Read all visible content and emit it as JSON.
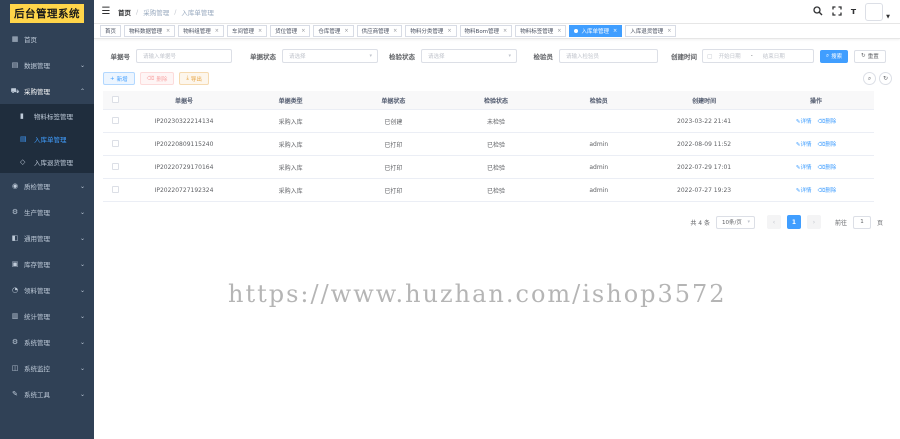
{
  "app": {
    "logo_text": "后台管理系统"
  },
  "sidebar": {
    "items": [
      {
        "label": "首页",
        "icon": "dashboard-icon",
        "glyph": "▦"
      },
      {
        "label": "数据管理",
        "icon": "data-icon",
        "glyph": "▤"
      },
      {
        "label": "采购管理",
        "icon": "cart-icon",
        "glyph": "⛟",
        "open": true
      },
      {
        "label": "质检管理",
        "icon": "inspect-icon",
        "glyph": "◉"
      },
      {
        "label": "生产管理",
        "icon": "production-icon",
        "glyph": "⚙"
      },
      {
        "label": "通用管理",
        "icon": "common-icon",
        "glyph": "◧"
      },
      {
        "label": "库存管理",
        "icon": "stock-icon",
        "glyph": "▣"
      },
      {
        "label": "领料管理",
        "icon": "material-icon",
        "glyph": "◔"
      },
      {
        "label": "统计管理",
        "icon": "stats-icon",
        "glyph": "▥"
      },
      {
        "label": "系统管理",
        "icon": "system-icon",
        "glyph": "⚙"
      },
      {
        "label": "系统监控",
        "icon": "monitor-icon",
        "glyph": "◫"
      },
      {
        "label": "系统工具",
        "icon": "tools-icon",
        "glyph": "✎"
      }
    ],
    "submenu": [
      {
        "label": "物料标签管理",
        "icon": "label-icon",
        "glyph": "▮"
      },
      {
        "label": "入库单管理",
        "icon": "receipt-icon",
        "glyph": "▤",
        "active": true
      },
      {
        "label": "入库退货管理",
        "icon": "return-icon",
        "glyph": "◇"
      }
    ]
  },
  "header": {
    "breadcrumb": [
      "首页",
      "采购管理",
      "入库单管理"
    ],
    "icons": [
      "search-icon",
      "fullscreen-icon",
      "font-size-icon"
    ]
  },
  "tags": [
    {
      "label": "首页",
      "closable": false
    },
    {
      "label": "物料数据管理",
      "closable": true
    },
    {
      "label": "物料组管理",
      "closable": true
    },
    {
      "label": "车间管理",
      "closable": true
    },
    {
      "label": "货位管理",
      "closable": true
    },
    {
      "label": "仓库管理",
      "closable": true
    },
    {
      "label": "供应商管理",
      "closable": true
    },
    {
      "label": "物料分类管理",
      "closable": true
    },
    {
      "label": "物料Bom管理",
      "closable": true
    },
    {
      "label": "物料标签管理",
      "closable": true
    },
    {
      "label": "入库单管理",
      "closable": true,
      "active": true
    },
    {
      "label": "入库退货管理",
      "closable": true
    }
  ],
  "search": {
    "order_no_label": "单据号",
    "order_no_placeholder": "请输入单据号",
    "status_label": "单据状态",
    "status_placeholder": "请选择",
    "check_status_label": "检验状态",
    "check_status_placeholder": "请选择",
    "inspector_label": "检验员",
    "inspector_placeholder": "请输入检验员",
    "created_label": "创建时间",
    "start_placeholder": "开始日期",
    "range_sep": "-",
    "end_placeholder": "结束日期",
    "search_btn": "搜索",
    "reset_btn": "重置"
  },
  "toolbar": {
    "add": "新增",
    "delete": "删除",
    "export": "导出"
  },
  "table": {
    "columns": [
      "单据号",
      "单据类型",
      "单据状态",
      "检验状态",
      "检验员",
      "创建时间",
      "操作"
    ],
    "rows": [
      [
        "IP20230322214134",
        "采购入库",
        "已创建",
        "未检验",
        "",
        "2023-03-22 21:41"
      ],
      [
        "IP20220809115240",
        "采购入库",
        "已打印",
        "已检验",
        "admin",
        "2022-08-09 11:52"
      ],
      [
        "IP20220729170164",
        "采购入库",
        "已打印",
        "已检验",
        "admin",
        "2022-07-29 17:01"
      ],
      [
        "IP20220727192324",
        "采购入库",
        "已打印",
        "已检验",
        "admin",
        "2022-07-27 19:23"
      ]
    ],
    "op_detail": "详情",
    "op_delete": "删除"
  },
  "pagination": {
    "total": "共 4 条",
    "page_size": "10条/页",
    "current": "1",
    "goto_label": "前往",
    "goto_value": "1",
    "goto_suffix": "页"
  },
  "watermark": "https://www.huzhan.com/ishop3572"
}
